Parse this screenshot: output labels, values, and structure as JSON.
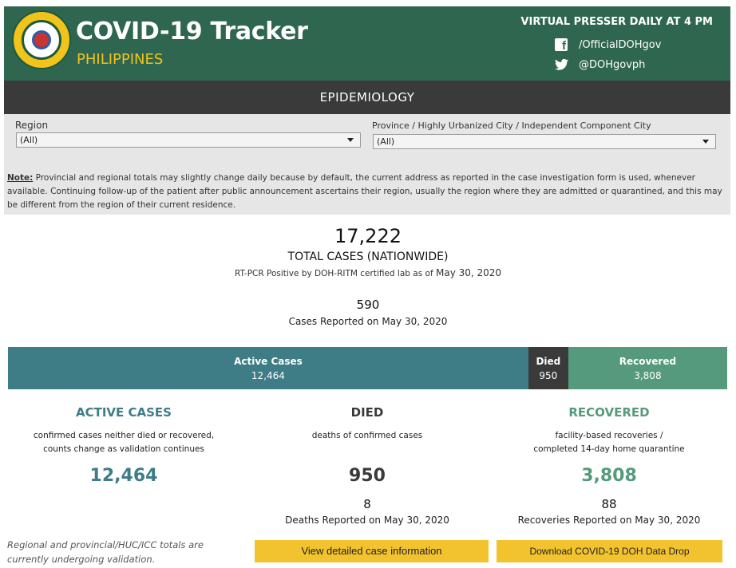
{
  "header": {
    "title": "COVID-19 Tracker",
    "subtitle": "PHILIPPINES",
    "presser": "VIRTUAL PRESSER DAILY AT 4 PM",
    "facebook": "/OfficialDOHgov",
    "twitter": "@DOHgovph",
    "seal_text": "REPUBLIC OF THE PHILIPPINES · DEPARTMENT OF HEALTH",
    "brand_color": "#2e6650",
    "accent_color": "#f2c31a"
  },
  "section": {
    "title": "EPIDEMIOLOGY"
  },
  "filters": {
    "region_label": "Region",
    "region_value": "(All)",
    "province_label": "Province / Highly Urbanized City / Independent Component City",
    "province_value": "(All)"
  },
  "note": {
    "label": "Note:",
    "text": " Provincial and regional totals may slightly change daily because by default, the current address as reported in the case investigation form is used, whenever available. Continuing follow-up of the patient after public announcement ascertains their region, usually the region where they are admitted or quarantined, and this may be different from the region of their current residence."
  },
  "totals": {
    "total_cases": "17,222",
    "total_label": "TOTAL CASES (NATIONWIDE)",
    "total_sub": "RT-PCR Positive by DOH-RITM certified lab as of",
    "total_date": "May 30, 2020",
    "reported_today": "590",
    "reported_label": "Cases Reported on May 30, 2020"
  },
  "breakdown_bar": {
    "segments": [
      {
        "label": "Active Cases",
        "value": "12,464",
        "amount": 12464,
        "color": "#3e7c86"
      },
      {
        "label": "Died",
        "value": "950",
        "amount": 950,
        "color": "#3a3a3a"
      },
      {
        "label": "Recovered",
        "value": "3,808",
        "amount": 3808,
        "color": "#559a7c"
      }
    ]
  },
  "columns": {
    "active": {
      "title": "ACTIVE CASES",
      "desc1": "confirmed cases neither died or recovered,",
      "desc2": "counts change as validation continues",
      "value": "12,464"
    },
    "died": {
      "title": "DIED",
      "desc1": "deaths of confirmed cases",
      "desc2": "",
      "value": "950",
      "reported": "8",
      "reported_label": "Deaths Reported on May 30, 2020"
    },
    "recovered": {
      "title": "RECOVERED",
      "desc1": "facility-based recoveries /",
      "desc2": "completed 14-day home quarantine",
      "value": "3,808",
      "reported": "88",
      "reported_label": "Recoveries Reported on May 30, 2020"
    }
  },
  "footer": {
    "validation_note": "Regional and provincial/HUC/ICC totals are currently undergoing validation.",
    "btn_details": "View detailed case information",
    "btn_download": "Download COVID-19 DOH Data Drop",
    "button_color": "#f2c32e"
  }
}
